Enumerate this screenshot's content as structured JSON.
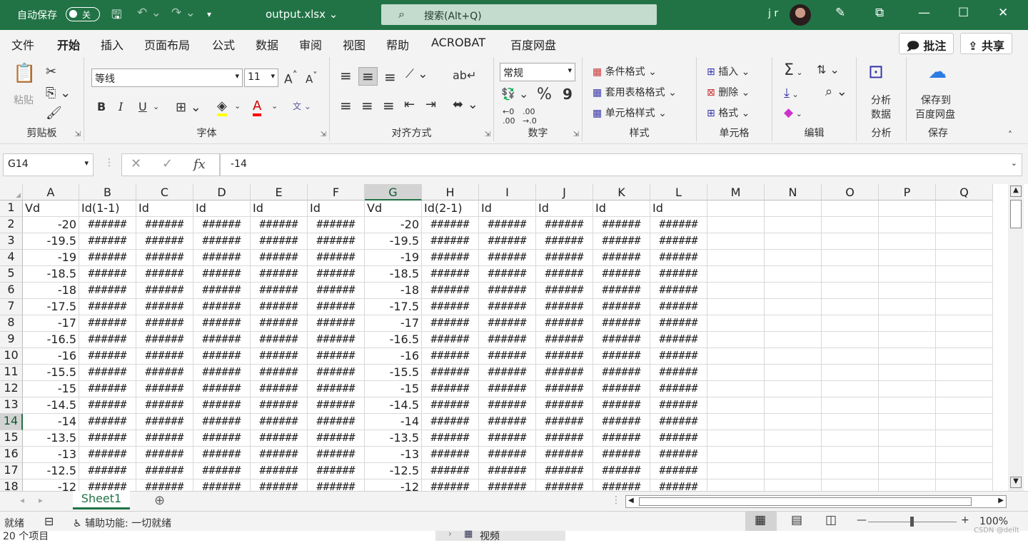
{
  "titlebar": {
    "autosave": "自动保存",
    "toggle": "关",
    "filename": "output.xlsx",
    "search": "搜索(Alt+Q)",
    "user": "j r"
  },
  "menu": {
    "tabs": [
      "文件",
      "开始",
      "插入",
      "页面布局",
      "公式",
      "数据",
      "审阅",
      "视图",
      "帮助",
      "ACROBAT",
      "百度网盘"
    ],
    "comment": "批注",
    "share": "共享"
  },
  "ribbon": {
    "clipboard": {
      "paste": "粘贴",
      "label": "剪贴板"
    },
    "font": {
      "name": "等线",
      "size": "11",
      "label": "字体",
      "bold": "B",
      "italic": "I",
      "underline": "U"
    },
    "align": {
      "label": "对齐方式"
    },
    "number": {
      "format": "常规",
      "label": "数字",
      "percent": "%",
      "comma": "9"
    },
    "styles": {
      "cond": "条件格式",
      "table": "套用表格格式",
      "cell": "单元格样式",
      "label": "样式"
    },
    "cells": {
      "insert": "插入",
      "delete": "删除",
      "format": "格式",
      "label": "单元格"
    },
    "editing": {
      "label": "编辑"
    },
    "analysis": {
      "btn1": "分析",
      "btn2": "数据",
      "label": "分析"
    },
    "save": {
      "btn1": "保存到",
      "btn2": "百度网盘",
      "label": "保存"
    }
  },
  "formula": {
    "cell": "G14",
    "value": "-14"
  },
  "sheet": {
    "columns": [
      "A",
      "B",
      "C",
      "D",
      "E",
      "F",
      "G",
      "H",
      "I",
      "J",
      "K",
      "L",
      "M",
      "N",
      "O",
      "P",
      "Q"
    ],
    "selected_col": "G",
    "selected_row": "14",
    "headers": [
      "Vd",
      "Id(1-1)",
      "Id",
      "Id",
      "Id",
      "Id",
      "Vd",
      "Id(2-1)",
      "Id",
      "Id",
      "Id",
      "Id"
    ],
    "vd": [
      "-20",
      "-19.5",
      "-19",
      "-18.5",
      "-18",
      "-17.5",
      "-17",
      "-16.5",
      "-16",
      "-15.5",
      "-15",
      "-14.5",
      "-14",
      "-13.5",
      "-13",
      "-12.5",
      "-12"
    ],
    "hash": "######"
  },
  "tabs": {
    "sheet": "Sheet1"
  },
  "status": {
    "ready": "就绪",
    "access": "辅助功能: 一切就绪",
    "zoom": "100%"
  },
  "bottom": {
    "items": "20 个项目",
    "folder": "视频",
    "watermark": "CSDN @dellt"
  }
}
